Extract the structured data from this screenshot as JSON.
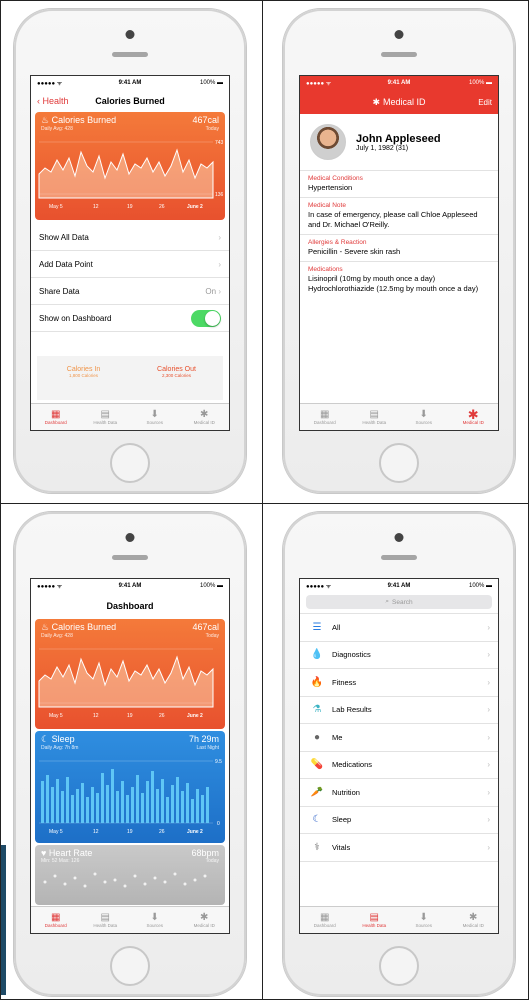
{
  "status": {
    "carrier": "●●●●● ᯤ",
    "time": "9:41 AM",
    "battery": "100% ▬"
  },
  "calories_screen": {
    "back_label": "Health",
    "title": "Calories Burned",
    "card": {
      "title": "Calories Burned",
      "value": "467cal",
      "sub": "Daily Avg: 428",
      "sub_right": "Today",
      "y_max": "743",
      "y_min": "136",
      "x_labels": [
        "May 5",
        "12",
        "19",
        "26",
        "June 2"
      ]
    },
    "rows": [
      {
        "label": "Show All Data",
        "value": ""
      },
      {
        "label": "Add Data Point",
        "value": ""
      },
      {
        "label": "Share Data",
        "value": "On"
      },
      {
        "label": "Show on Dashboard",
        "value": ""
      }
    ],
    "footer": {
      "left_title": "Calories In",
      "left_sub": "1,800 Calories",
      "right_title": "Calories Out",
      "right_sub": "2,300 Calories"
    }
  },
  "medical_screen": {
    "title": "Medical ID",
    "edit": "Edit",
    "name": "John Appleseed",
    "dob": "July 1, 1982 (31)",
    "sections": [
      {
        "title": "Medical Conditions",
        "value": "Hypertension"
      },
      {
        "title": "Medical Note",
        "value": "In case of emergency, please call Chloe Appleseed and Dr. Michael O'Reilly."
      },
      {
        "title": "Allergies & Reaction",
        "value": "Penicillin - Severe skin rash"
      },
      {
        "title": "Medications",
        "value": "Lisinopril (10mg by mouth once a day) Hydrochlorothiazide (12.5mg by mouth once a day)"
      }
    ]
  },
  "dashboard_screen": {
    "title": "Dashboard",
    "calories": {
      "title": "Calories Burned",
      "value": "467cal",
      "sub": "Daily Avg: 428",
      "sub_right": "Today",
      "x_labels": [
        "May 5",
        "12",
        "19",
        "26",
        "June 2"
      ]
    },
    "sleep": {
      "title": "Sleep",
      "value": "7h 29m",
      "sub": "Daily Avg: 7h 8m",
      "sub_right": "Last Night",
      "y_max": "9.5",
      "y_min": "0",
      "x_labels": [
        "May 5",
        "12",
        "19",
        "26",
        "June 2"
      ]
    },
    "heart": {
      "title": "Heart Rate",
      "value": "68bpm",
      "sub": "Min: 52 Max: 126",
      "sub_right": "Today"
    }
  },
  "health_data_screen": {
    "search_placeholder": "Search",
    "categories": [
      {
        "label": "All",
        "icon": "list-icon",
        "glyph": "☰",
        "color": "#2a7de1"
      },
      {
        "label": "Diagnostics",
        "icon": "droplet-icon",
        "glyph": "💧",
        "color": "#3a8fd9"
      },
      {
        "label": "Fitness",
        "icon": "flame-icon",
        "glyph": "🔥",
        "color": "#e8512e"
      },
      {
        "label": "Lab Results",
        "icon": "flask-icon",
        "glyph": "⚗",
        "color": "#3bb3c3"
      },
      {
        "label": "Me",
        "icon": "person-icon",
        "glyph": "●",
        "color": "#666666"
      },
      {
        "label": "Medications",
        "icon": "pill-icon",
        "glyph": "💊",
        "color": "#e6c229"
      },
      {
        "label": "Nutrition",
        "icon": "carrot-icon",
        "glyph": "🥕",
        "color": "#f08a24"
      },
      {
        "label": "Sleep",
        "icon": "moon-icon",
        "glyph": "☾",
        "color": "#2a5fc7"
      },
      {
        "label": "Vitals",
        "icon": "stethoscope-icon",
        "glyph": "⚕",
        "color": "#666666"
      }
    ]
  },
  "tabs": [
    {
      "label": "Dashboard",
      "icon": "chart-icon",
      "glyph": "▦"
    },
    {
      "label": "Health Data",
      "icon": "folder-icon",
      "glyph": "▤"
    },
    {
      "label": "Sources",
      "icon": "download-icon",
      "glyph": "⬇"
    },
    {
      "label": "Medical ID",
      "icon": "asterisk-icon",
      "glyph": "✱"
    }
  ],
  "colors": {
    "accent_red": "#e03a3a",
    "orange": "#e8512e",
    "blue": "#1d6fc7",
    "green": "#4cd964"
  }
}
